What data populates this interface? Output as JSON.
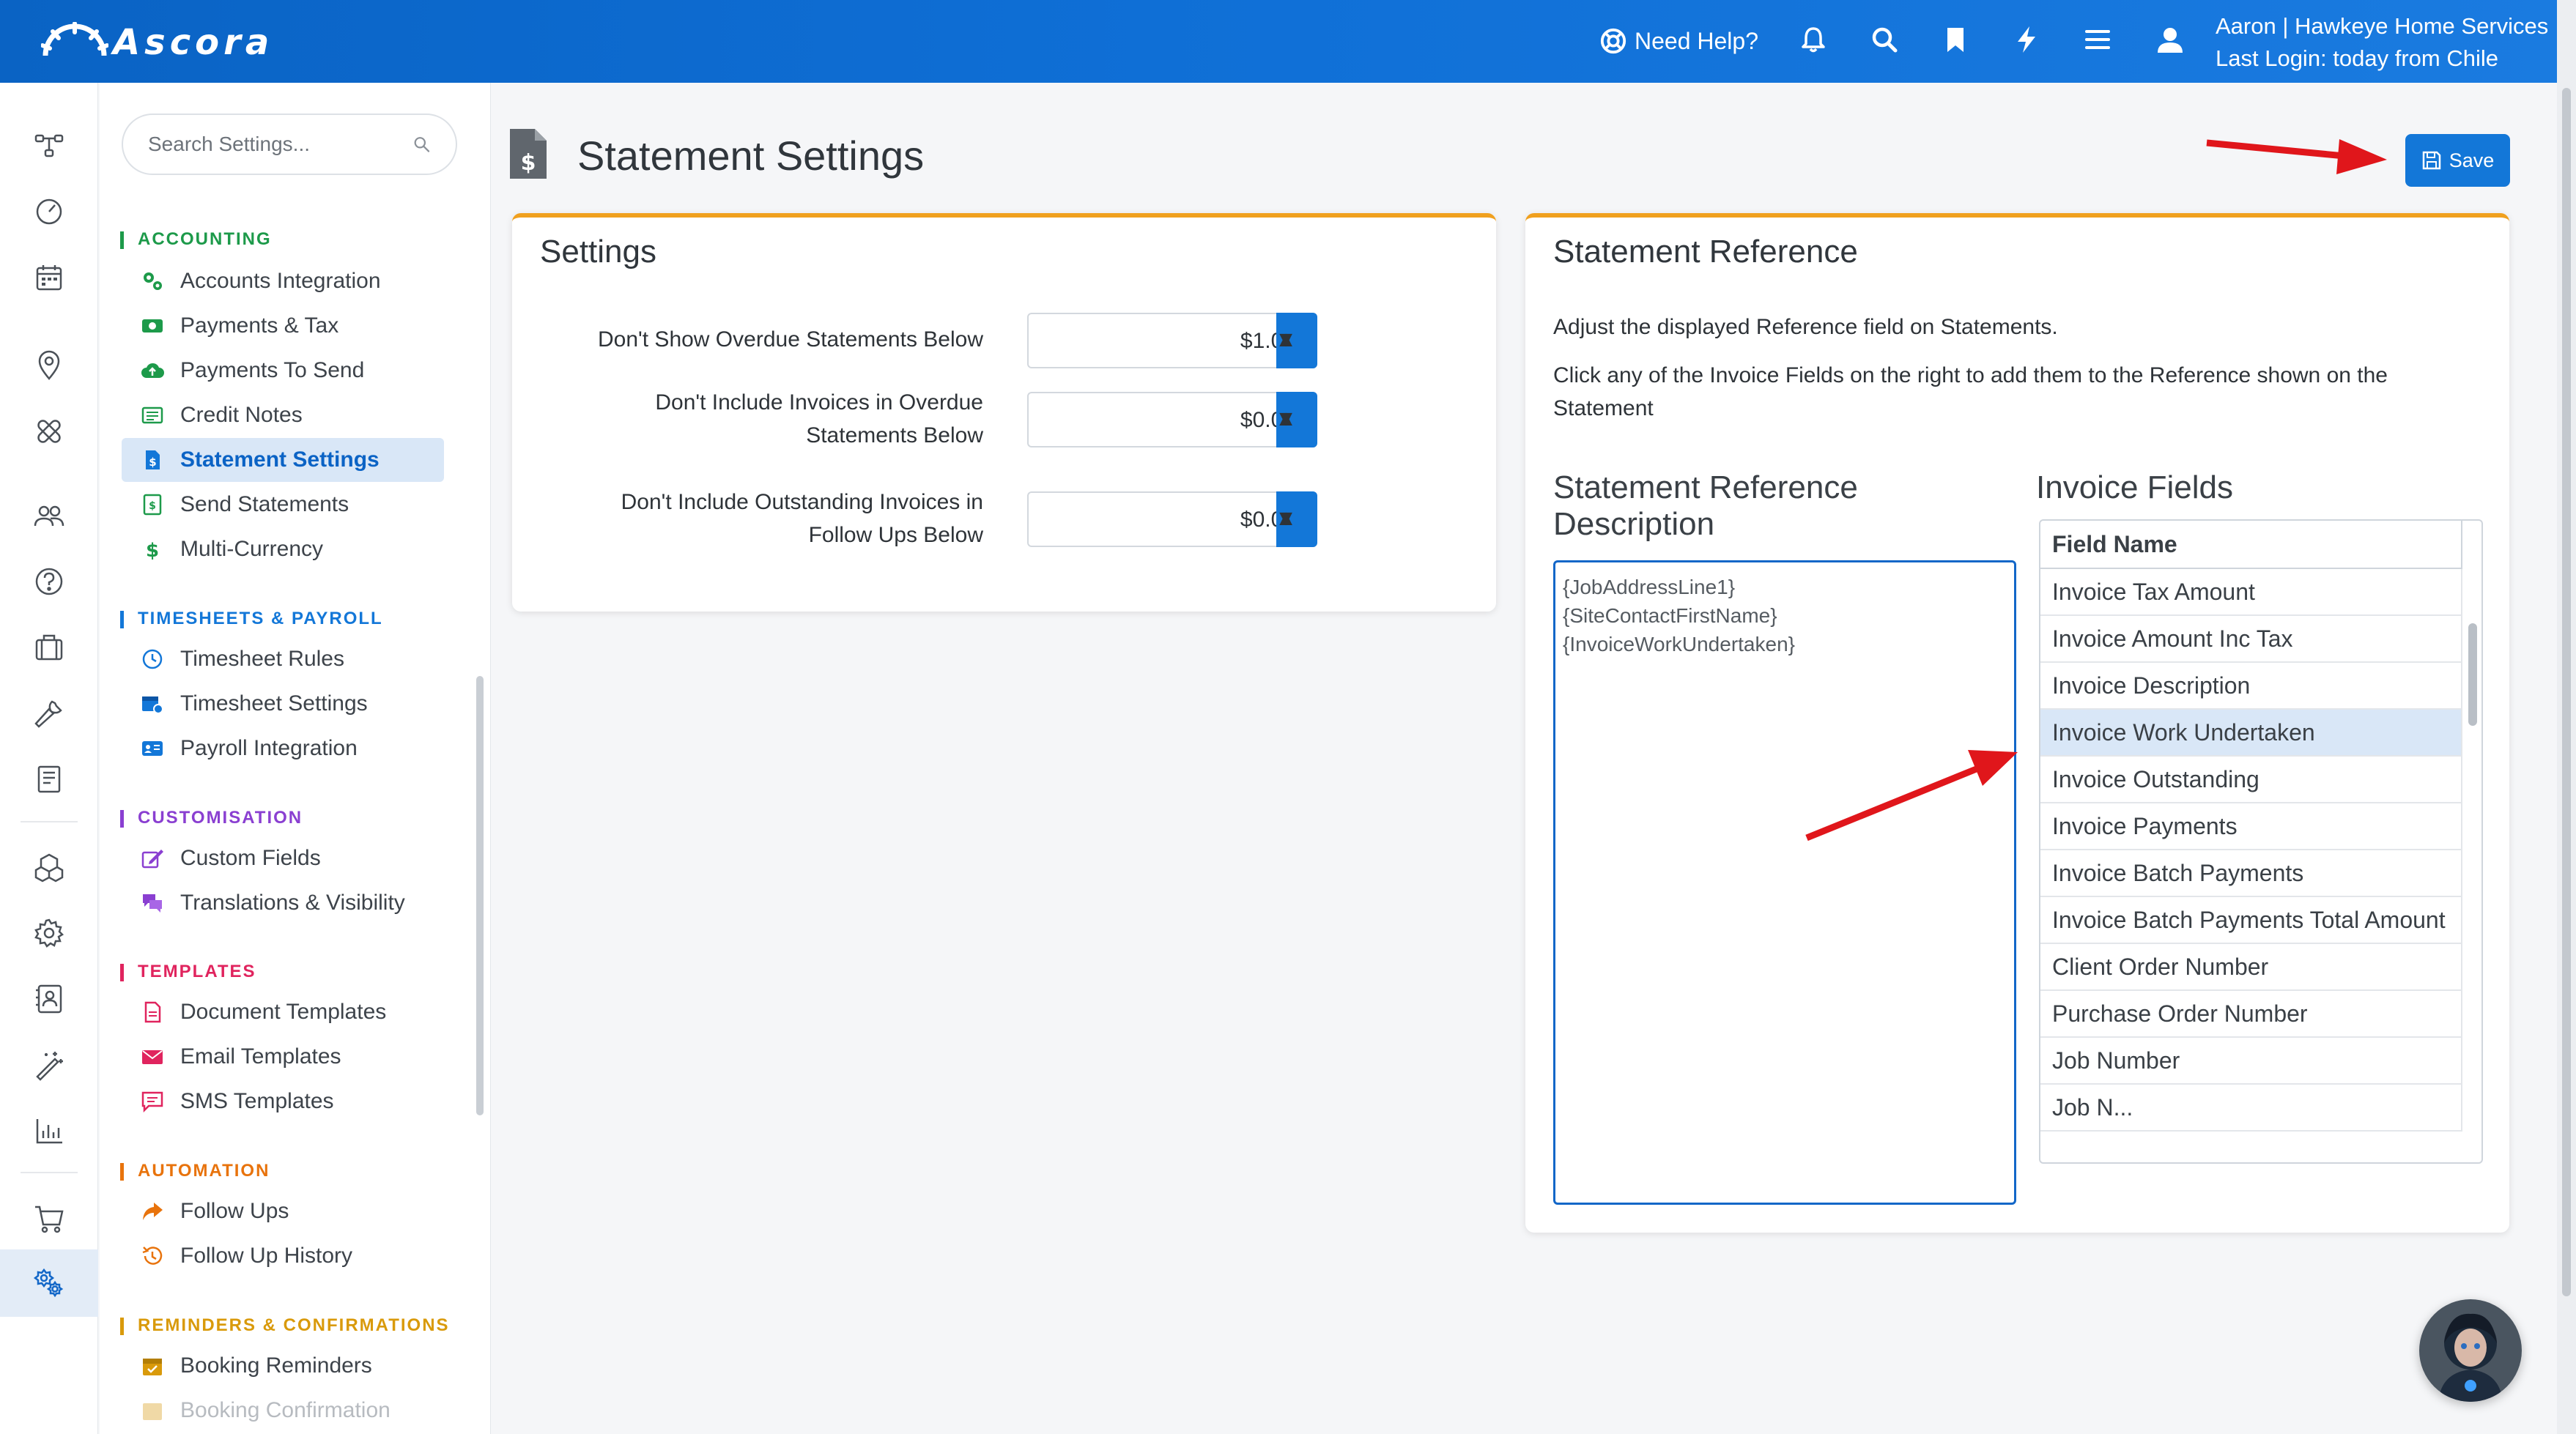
{
  "app": {
    "logo_text": "Ascora"
  },
  "topbar": {
    "help_label": "Need Help?",
    "icons": [
      "bell-icon",
      "search-icon",
      "bookmark-icon",
      "lightning-icon",
      "menu-icon",
      "user-icon"
    ],
    "user_line1": "Aaron | Hawkeye Home Services",
    "user_line2": "Last Login: today from Chile"
  },
  "rail": {
    "icons": [
      "flow-icon",
      "dashboard-icon",
      "calendar-icon",
      "location-icon",
      "bandage-icon",
      "people-icon",
      "help-icon",
      "briefcase-icon",
      "wrench-icon",
      "notebook-icon",
      "boxes-icon",
      "gear-icon",
      "contact-icon",
      "magic-wand-icon",
      "chart-icon",
      "cart-icon",
      "settings-gears-icon",
      "expand-icon"
    ],
    "active": "settings-gears-icon"
  },
  "settings_nav": {
    "search_placeholder": "Search Settings...",
    "sections": [
      {
        "title": "ACCOUNTING",
        "color": "#1d9a4a",
        "items": [
          "Accounts Integration",
          "Payments & Tax",
          "Payments To Send",
          "Credit Notes",
          "Statement Settings",
          "Send Statements",
          "Multi-Currency"
        ]
      },
      {
        "title": "TIMESHEETS & PAYROLL",
        "color": "#1377d8",
        "items": [
          "Timesheet Rules",
          "Timesheet Settings",
          "Payroll Integration"
        ]
      },
      {
        "title": "CUSTOMISATION",
        "color": "#8a3fd1",
        "items": [
          "Custom Fields",
          "Translations & Visibility"
        ]
      },
      {
        "title": "TEMPLATES",
        "color": "#e0245e",
        "items": [
          "Document Templates",
          "Email Templates",
          "SMS Templates"
        ]
      },
      {
        "title": "AUTOMATION",
        "color": "#e8730c",
        "items": [
          "Follow Ups",
          "Follow Up History"
        ]
      },
      {
        "title": "REMINDERS & CONFIRMATIONS",
        "color": "#d99a0b",
        "items": [
          "Booking Reminders",
          "Booking Confirmation"
        ]
      }
    ],
    "active_item": "Statement Settings"
  },
  "page": {
    "title": "Statement Settings",
    "save_label": "Save"
  },
  "settings_card": {
    "title": "Settings",
    "fields": [
      {
        "label": "Don't Show Overdue Statements Below",
        "value": "$1.00"
      },
      {
        "label": "Don't Include Invoices in Overdue Statements Below",
        "value": "$0.05"
      },
      {
        "label": "Don't Include Outstanding Invoices in Follow Ups Below",
        "value": "$0.00"
      }
    ]
  },
  "reference_card": {
    "title": "Statement Reference",
    "desc1": "Adjust the displayed Reference field on Statements.",
    "desc2": "Click any of the Invoice Fields on the right to add them to the Reference shown on the Statement",
    "ref_title": "Statement Reference Description",
    "ref_lines": [
      "{JobAddressLine1}",
      "{SiteContactFirstName}",
      "{InvoiceWorkUndertaken}"
    ],
    "fields_title": "Invoice Fields",
    "table_header": "Field Name",
    "fields": [
      "Invoice Tax Amount",
      "Invoice Amount Inc Tax",
      "Invoice Description",
      "Invoice Work Undertaken",
      "Invoice Outstanding",
      "Invoice Payments",
      "Invoice Batch Payments",
      "Invoice Batch Payments Total Amount",
      "Client Order Number",
      "Purchase Order Number",
      "Job Number",
      "Job N..."
    ],
    "selected_field": "Invoice Work Undertaken"
  },
  "colors": {
    "topbar": "#0f6fd6",
    "accent": "#1377d8",
    "card_border": "#f0a01e",
    "arrow": "#e0161b"
  }
}
